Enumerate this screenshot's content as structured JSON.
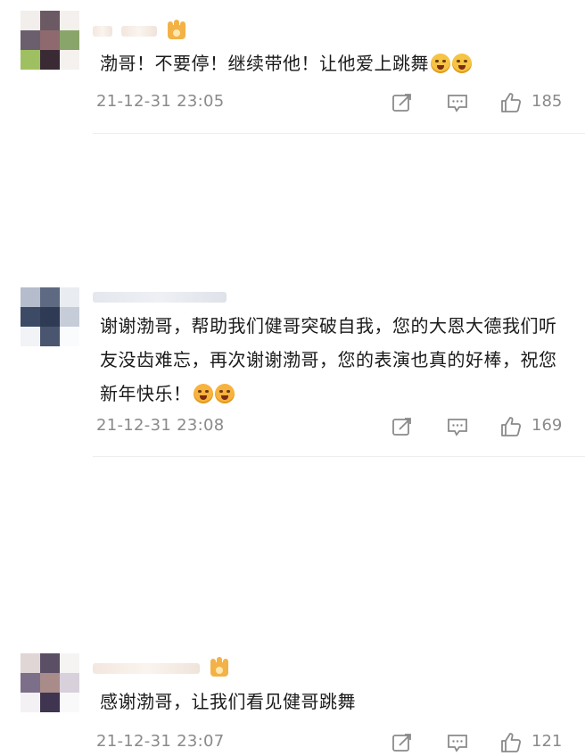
{
  "comments": [
    {
      "text": "渤哥！不要停！继续带他！让他爱上跳舞",
      "emoji": [
        "face-emoji",
        "face-emoji"
      ],
      "time": "21-12-31 23:05",
      "likes": "185",
      "has_crown": true
    },
    {
      "text": "谢谢渤哥，帮助我们健哥突破自我，您的大恩大德我们听友没齿难忘，再次谢谢渤哥，您的表演也真的好棒，祝您新年快乐！",
      "emoji": [
        "heart-eyes-emoji",
        "heart-eyes-emoji"
      ],
      "time": "21-12-31 23:08",
      "likes": "169",
      "has_crown": false
    },
    {
      "text": "感谢渤哥，让我们看见健哥跳舞",
      "emoji": [],
      "time": "21-12-31 23:07",
      "likes": "121",
      "has_crown": true
    }
  ],
  "icons": {
    "share": "share-icon",
    "comment": "comment-icon",
    "like": "thumbs-up-icon",
    "crown": "crown-badge-icon"
  },
  "colors": {
    "text": "#1a1a1a",
    "meta": "#8a8a8a",
    "crown": "#f3b247"
  }
}
